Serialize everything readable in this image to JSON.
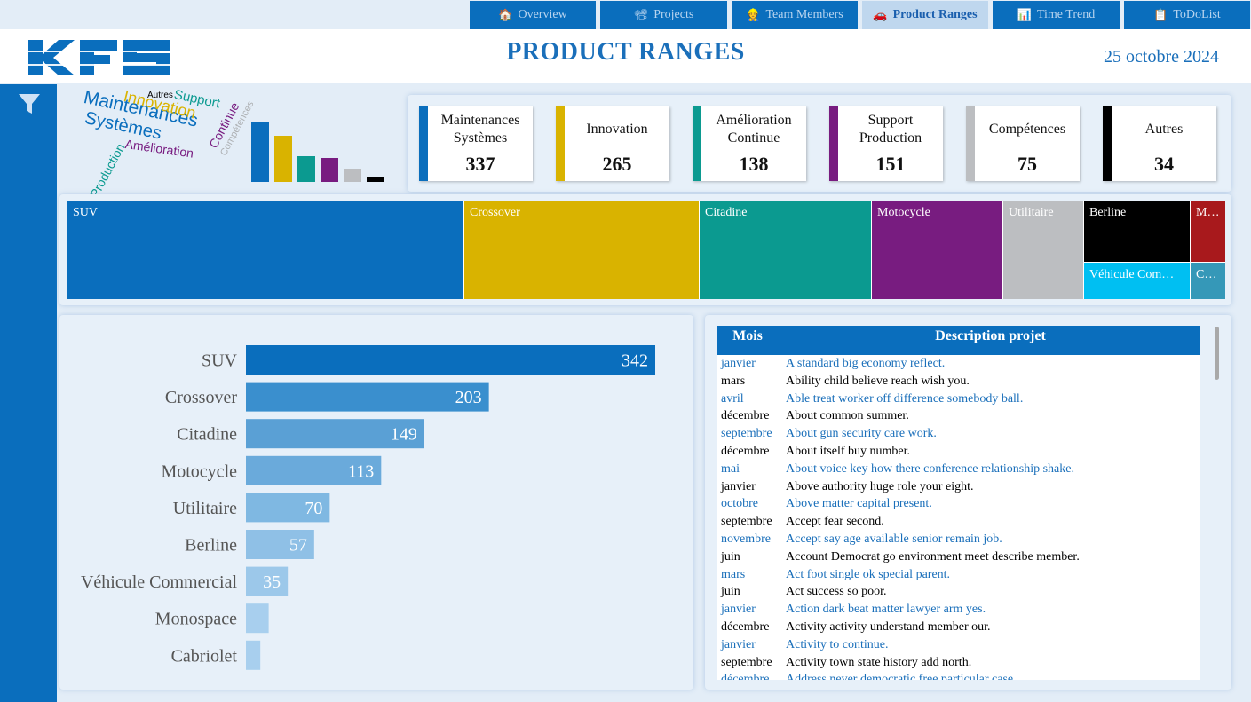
{
  "nav": {
    "tabs": [
      {
        "label": "Overview",
        "icon": "house-icon",
        "active": false
      },
      {
        "label": "Projects",
        "icon": "projector-icon",
        "active": false
      },
      {
        "label": "Team Members",
        "icon": "person-icon",
        "active": false
      },
      {
        "label": "Product Ranges",
        "icon": "car-icon",
        "active": true
      },
      {
        "label": "Time Trend",
        "icon": "chart-icon",
        "active": false
      },
      {
        "label": "ToDoList",
        "icon": "clipboard-icon",
        "active": false
      }
    ]
  },
  "header": {
    "logo_text": "KFS",
    "title": "PRODUCT RANGES",
    "date": "25 octobre 2024"
  },
  "sidebar": {
    "icon": "filter-icon"
  },
  "colors": {
    "blue": "#0a6ebd",
    "gold": "#d9b300",
    "teal": "#0b9a90",
    "purple": "#781c80",
    "grey": "#bcbec1",
    "black": "#000000",
    "red": "#a8191c",
    "cyan": "#00bff2",
    "steel": "#3598b8"
  },
  "wordcloud": {
    "words": [
      "Maintenances",
      "Systèmes",
      "Innovation",
      "Support",
      "Autres",
      "Continue",
      "Compétences",
      "Production",
      "Amélioration"
    ]
  },
  "kpis": [
    {
      "label": "Maintenances Systèmes",
      "value": "337",
      "color": "#0a6ebd"
    },
    {
      "label": "Innovation",
      "value": "265",
      "color": "#d9b300"
    },
    {
      "label": "Amélioration Continue",
      "value": "138",
      "color": "#0b9a90"
    },
    {
      "label": "Support Production",
      "value": "151",
      "color": "#781c80"
    },
    {
      "label": "Compétences",
      "value": "75",
      "color": "#bcbec1"
    },
    {
      "label": "Autres",
      "value": "34",
      "color": "#000000"
    }
  ],
  "treemap": {
    "tiles": [
      {
        "label": "SUV",
        "color": "#0a6ebd"
      },
      {
        "label": "Crossover",
        "color": "#d9b300"
      },
      {
        "label": "Citadine",
        "color": "#0b9a90"
      },
      {
        "label": "Motocycle",
        "color": "#781c80"
      },
      {
        "label": "Utilitaire",
        "color": "#bcbec1"
      },
      {
        "label": "Berline",
        "color": "#000000"
      },
      {
        "label": "Véhicule Com…",
        "color": "#00bff2"
      },
      {
        "label": "M…",
        "color": "#a8191c"
      },
      {
        "label": "C…",
        "color": "#3598b8"
      }
    ]
  },
  "chart_data": {
    "type": "bar",
    "orientation": "horizontal",
    "categories": [
      "SUV",
      "Crossover",
      "Citadine",
      "Motocycle",
      "Utilitaire",
      "Berline",
      "Véhicule Commercial",
      "Monospace",
      "Cabriolet"
    ],
    "values": [
      342,
      203,
      149,
      113,
      70,
      57,
      35,
      19,
      12
    ],
    "data_labels": [
      "342",
      "203",
      "149",
      "113",
      "70",
      "57",
      "35",
      "",
      ""
    ],
    "colors": [
      "#0a6ebd",
      "#3a8fce",
      "#5aa0d5",
      "#6aaadb",
      "#7fb8e2",
      "#8fc0e6",
      "#9cc8ea",
      "#a8cfee",
      "#a8cfee"
    ],
    "xlim": [
      0,
      342
    ]
  },
  "table": {
    "columns": [
      "Mois",
      "Description projet"
    ],
    "rows": [
      {
        "mois": "janvier",
        "desc": "A standard big economy reflect."
      },
      {
        "mois": "mars",
        "desc": "Ability child believe reach wish you."
      },
      {
        "mois": "avril",
        "desc": "Able treat worker off difference somebody ball."
      },
      {
        "mois": "décembre",
        "desc": "About common summer."
      },
      {
        "mois": "septembre",
        "desc": "About gun security care work."
      },
      {
        "mois": "décembre",
        "desc": "About itself buy number."
      },
      {
        "mois": "mai",
        "desc": "About voice key how there conference relationship shake."
      },
      {
        "mois": "janvier",
        "desc": "Above authority huge role your eight."
      },
      {
        "mois": "octobre",
        "desc": "Above matter capital present."
      },
      {
        "mois": "septembre",
        "desc": "Accept fear second."
      },
      {
        "mois": "novembre",
        "desc": "Accept say age available senior remain job."
      },
      {
        "mois": "juin",
        "desc": "Account Democrat go environment meet describe member."
      },
      {
        "mois": "mars",
        "desc": "Act foot single ok special parent."
      },
      {
        "mois": "juin",
        "desc": "Act success so poor."
      },
      {
        "mois": "janvier",
        "desc": "Action dark beat matter lawyer arm yes."
      },
      {
        "mois": "décembre",
        "desc": "Activity activity understand member our."
      },
      {
        "mois": "janvier",
        "desc": "Activity to continue."
      },
      {
        "mois": "septembre",
        "desc": "Activity town state history add north."
      },
      {
        "mois": "décembre",
        "desc": "Address never democratic free particular case."
      }
    ]
  }
}
